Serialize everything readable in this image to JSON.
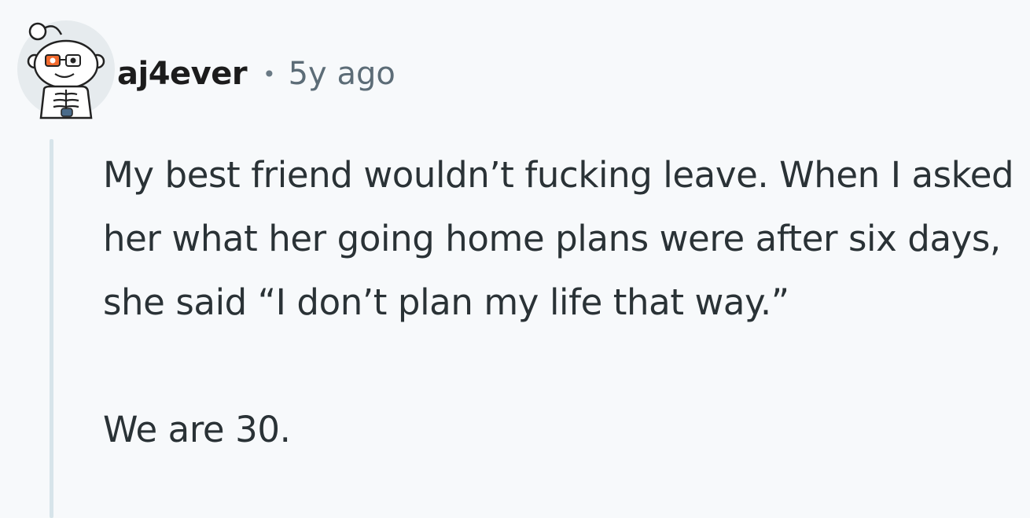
{
  "comment": {
    "username": "aj4ever",
    "separator": "•",
    "timestamp": "5y ago",
    "paragraphs": [
      "My best friend wouldn’t fucking leave. When I asked her what her going home plans were after six days, she said “I don’t plan my life that way.”",
      "We are 30."
    ]
  },
  "icons": {
    "avatar": "reddit-snoo-avatar-icon"
  }
}
